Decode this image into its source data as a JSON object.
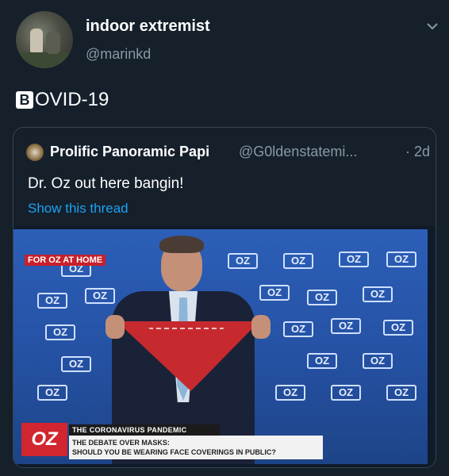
{
  "tweet": {
    "display_name": "indoor extremist",
    "handle": "@marinkd",
    "text_emoji": "B",
    "text_rest": "OVID-19",
    "menu_icon": "chevron-down-icon"
  },
  "quoted_tweet": {
    "name": "Prolific Panoramic Papi",
    "handle": "@G0ldenstatemi...",
    "time": "· 2d",
    "text": "Dr. Oz out here bangin!",
    "show_thread": "Show this thread"
  },
  "media": {
    "tag": "FOR OZ AT HOME",
    "backdrop_logo": "OZ",
    "lower_third_logo": "OZ",
    "lower_third_header": "THE CORONAVIRUS PANDEMIC",
    "lower_third_line1": "THE DEBATE OVER MASKS:",
    "lower_third_line2": "SHOULD YOU BE WEARING FACE COVERINGS IN PUBLIC?"
  },
  "colors": {
    "background": "#15202b",
    "muted": "#8899a6",
    "link": "#1da1f2",
    "border": "#38444d"
  }
}
